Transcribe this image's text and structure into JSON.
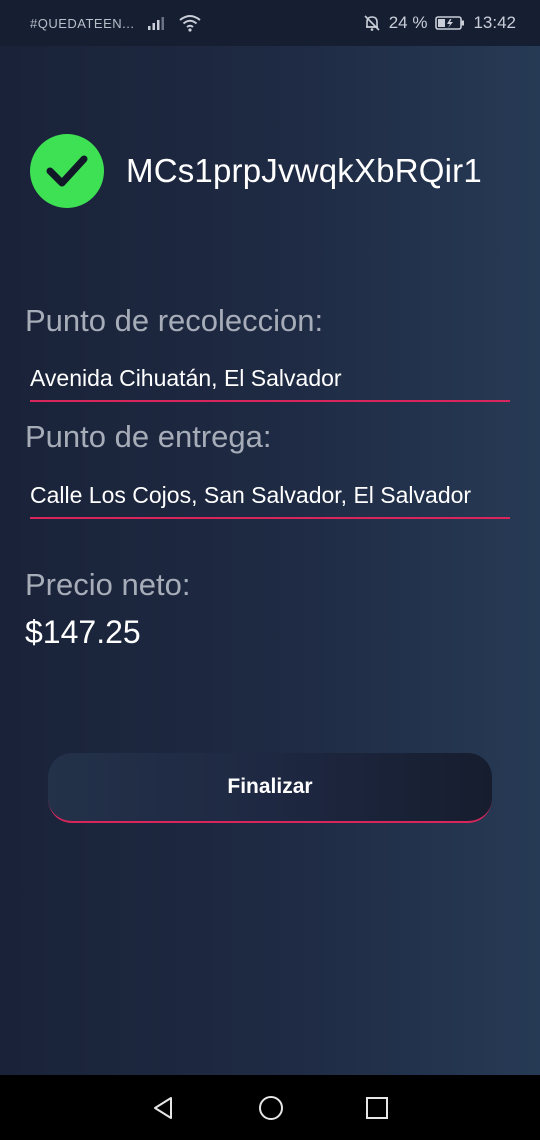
{
  "status_bar": {
    "carrier": "#QUEDATEEN...",
    "battery_percent": "24 %",
    "time": "13:42",
    "icons": [
      "signal-icon",
      "wifi-icon",
      "mute-bell-icon",
      "battery-icon"
    ]
  },
  "order": {
    "status_icon": "check-circle-icon",
    "id": "MCs1prpJvwqkXbRQir1"
  },
  "pickup": {
    "label": "Punto de recoleccion:",
    "value": "Avenida Cihuatán, El Salvador"
  },
  "delivery": {
    "label": "Punto de entrega:",
    "value": "Calle Los Cojos, San Salvador, El Salvador"
  },
  "price": {
    "label": "Precio neto:",
    "value": "$147.25"
  },
  "actions": {
    "finish_label": "Finalizar"
  },
  "colors": {
    "accent": "#d8265c",
    "success": "#3fe154",
    "background": "#1f2b44"
  },
  "nav_bar": {
    "icons": [
      "back-icon",
      "home-icon",
      "recents-icon"
    ]
  }
}
